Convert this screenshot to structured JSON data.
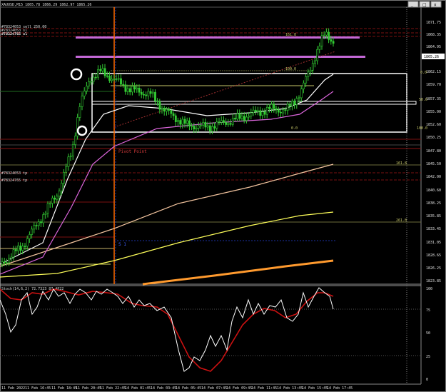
{
  "title": "XAUUSD,M15",
  "header_quote": "1865.78 1866.29 1862.97 1865.26",
  "window_buttons": [
    "_",
    "□",
    "x"
  ],
  "orders": [
    "#78324053 sell 250.00",
    "#78324053 sl",
    "#78324765 sl"
  ],
  "tp_labels": [
    "#78324053 tp",
    "#78324765 tp"
  ],
  "fib_labels": [
    "161.8",
    "100.0",
    "0.0",
    "50.0",
    "100.0",
    "161.8",
    "261.8"
  ],
  "zone_labels": [
    "0.0",
    "50.0",
    "100.0"
  ],
  "pivot_label": "Pivot Point",
  "s1_label": "S 1",
  "price_axis": [
    "1871.75",
    "1868.35",
    "1864.95",
    "1862.15",
    "1859.70",
    "1857.35",
    "1855.00",
    "1852.60",
    "1850.25",
    "1847.80",
    "1845.50",
    "1842.00",
    "1840.60",
    "1838.25",
    "1835.85",
    "1833.45",
    "1831.05",
    "1828.65",
    "1826.25",
    "1823.85"
  ],
  "current_price": "1865.26",
  "stoch_label": "Stoch(14,6,2) 72.7323 87.4822",
  "stoch_axis": [
    "100",
    "75",
    "50",
    "25",
    "0"
  ],
  "time_axis": [
    "11 Feb 2022",
    "11 Feb 16:45",
    "11 Feb 18:45",
    "11 Feb 20:45",
    "11 Feb 22:45",
    "14 Feb 01:45",
    "14 Feb 03:45",
    "14 Feb 05:45",
    "14 Feb 07:45",
    "14 Feb 09:45",
    "14 Feb 11:45",
    "14 Feb 13:45",
    "14 Feb 15:45",
    "14 Feb 17:45"
  ]
}
